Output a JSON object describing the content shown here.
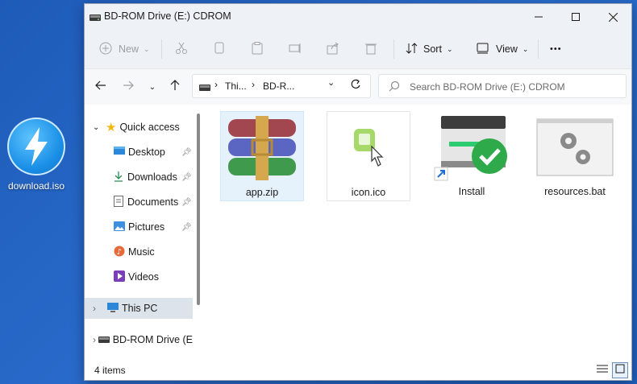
{
  "desktop": {
    "icon_label": "download.iso",
    "icon_name": "disc-image-icon"
  },
  "window": {
    "title": "BD-ROM Drive (E:) CDROM",
    "controls": {
      "minimize": "—",
      "maximize": "☐",
      "close": "✕"
    }
  },
  "toolbar": {
    "new_label": "New",
    "sort_label": "Sort",
    "view_label": "View",
    "more_label": "•••"
  },
  "address": {
    "crumbs": [
      "Thi...",
      "BD-R..."
    ],
    "search_placeholder": "Search BD-ROM Drive (E:) CDROM"
  },
  "sidebar": {
    "quick_access": "Quick access",
    "items": [
      {
        "label": "Desktop",
        "icon": "desktop-icon",
        "pinned": true
      },
      {
        "label": "Downloads",
        "icon": "download-icon",
        "pinned": true
      },
      {
        "label": "Documents",
        "icon": "documents-icon",
        "pinned": true
      },
      {
        "label": "Pictures",
        "icon": "pictures-icon",
        "pinned": true
      },
      {
        "label": "Music",
        "icon": "music-icon",
        "pinned": false
      },
      {
        "label": "Videos",
        "icon": "videos-icon",
        "pinned": false
      }
    ],
    "this_pc": "This PC",
    "drive": "BD-ROM Drive (E"
  },
  "files": [
    {
      "name": "app.zip",
      "icon": "archive-icon"
    },
    {
      "name": "icon.ico",
      "icon": "ico-file-icon"
    },
    {
      "name": "Install",
      "icon": "installer-shortcut-icon"
    },
    {
      "name": "resources.bat",
      "icon": "batch-file-icon"
    }
  ],
  "status": {
    "item_count": "4 items"
  },
  "colors": {
    "accent": "#0067c0",
    "selection": "#e5f1fb",
    "desktop_bg": "#2a6ccc"
  }
}
